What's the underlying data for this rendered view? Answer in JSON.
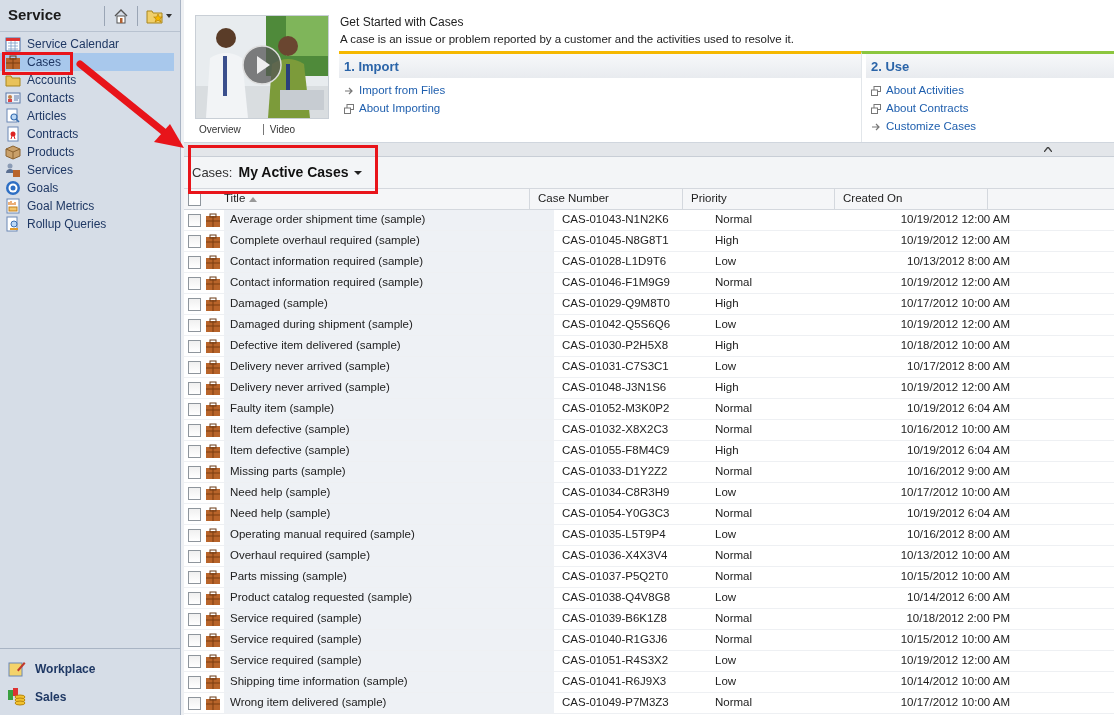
{
  "sidebar": {
    "title": "Service",
    "items": [
      {
        "label": "Service Calendar",
        "selected": false
      },
      {
        "label": "Cases",
        "selected": true
      },
      {
        "label": "Accounts",
        "selected": false
      },
      {
        "label": "Contacts",
        "selected": false
      },
      {
        "label": "Articles",
        "selected": false
      },
      {
        "label": "Contracts",
        "selected": false
      },
      {
        "label": "Products",
        "selected": false
      },
      {
        "label": "Services",
        "selected": false
      },
      {
        "label": "Goals",
        "selected": false
      },
      {
        "label": "Goal Metrics",
        "selected": false
      },
      {
        "label": "Rollup Queries",
        "selected": false
      }
    ],
    "areas": [
      {
        "label": "Workplace"
      },
      {
        "label": "Sales"
      }
    ]
  },
  "get_started": {
    "title": "Get Started with Cases",
    "description": "A case is an issue or problem reported by a customer and the activities used to resolve it.",
    "video_links": [
      "Overview",
      "Video"
    ],
    "sections": [
      {
        "heading": "1. Import",
        "color": "#f5b800",
        "links": [
          {
            "label": "Import from Files",
            "kind": "arrow"
          },
          {
            "label": "About Importing",
            "kind": "window"
          }
        ]
      },
      {
        "heading": "2. Use",
        "color": "#8cc63f",
        "links": [
          {
            "label": "About Activities",
            "kind": "window"
          },
          {
            "label": "About Contracts",
            "kind": "window"
          },
          {
            "label": "Customize Cases",
            "kind": "arrow"
          }
        ]
      }
    ]
  },
  "view": {
    "label": "Cases:",
    "name": "My Active Cases"
  },
  "table": {
    "select_all_checked": false,
    "columns": [
      "Title",
      "Case Number",
      "Priority",
      "Created On"
    ],
    "rows": [
      {
        "title": "Average order shipment time (sample)",
        "case_number": "CAS-01043-N1N2K6",
        "priority": "Normal",
        "created_on": "10/19/2012 12:00 AM",
        "checked": false
      },
      {
        "title": "Complete overhaul required (sample)",
        "case_number": "CAS-01045-N8G8T1",
        "priority": "High",
        "created_on": "10/19/2012 12:00 AM",
        "checked": false
      },
      {
        "title": "Contact information required (sample)",
        "case_number": "CAS-01028-L1D9T6",
        "priority": "Low",
        "created_on": "10/13/2012 8:00 AM",
        "checked": false
      },
      {
        "title": "Contact information required (sample)",
        "case_number": "CAS-01046-F1M9G9",
        "priority": "Normal",
        "created_on": "10/19/2012 12:00 AM",
        "checked": false
      },
      {
        "title": "Damaged (sample)",
        "case_number": "CAS-01029-Q9M8T0",
        "priority": "High",
        "created_on": "10/17/2012 10:00 AM",
        "checked": false
      },
      {
        "title": "Damaged during shipment (sample)",
        "case_number": "CAS-01042-Q5S6Q6",
        "priority": "Low",
        "created_on": "10/19/2012 12:00 AM",
        "checked": false
      },
      {
        "title": "Defective item delivered (sample)",
        "case_number": "CAS-01030-P2H5X8",
        "priority": "High",
        "created_on": "10/18/2012 10:00 AM",
        "checked": false
      },
      {
        "title": "Delivery never arrived (sample)",
        "case_number": "CAS-01031-C7S3C1",
        "priority": "Low",
        "created_on": "10/17/2012 8:00 AM",
        "checked": false
      },
      {
        "title": "Delivery never arrived (sample)",
        "case_number": "CAS-01048-J3N1S6",
        "priority": "High",
        "created_on": "10/19/2012 12:00 AM",
        "checked": false
      },
      {
        "title": "Faulty item (sample)",
        "case_number": "CAS-01052-M3K0P2",
        "priority": "Normal",
        "created_on": "10/19/2012 6:04 AM",
        "checked": false
      },
      {
        "title": "Item defective (sample)",
        "case_number": "CAS-01032-X8X2C3",
        "priority": "Normal",
        "created_on": "10/16/2012 10:00 AM",
        "checked": false
      },
      {
        "title": "Item defective (sample)",
        "case_number": "CAS-01055-F8M4C9",
        "priority": "High",
        "created_on": "10/19/2012 6:04 AM",
        "checked": false
      },
      {
        "title": "Missing parts (sample)",
        "case_number": "CAS-01033-D1Y2Z2",
        "priority": "Normal",
        "created_on": "10/16/2012 9:00 AM",
        "checked": false
      },
      {
        "title": "Need help (sample)",
        "case_number": "CAS-01034-C8R3H9",
        "priority": "Low",
        "created_on": "10/17/2012 10:00 AM",
        "checked": false
      },
      {
        "title": "Need help (sample)",
        "case_number": "CAS-01054-Y0G3C3",
        "priority": "Normal",
        "created_on": "10/19/2012 6:04 AM",
        "checked": false
      },
      {
        "title": "Operating manual required (sample)",
        "case_number": "CAS-01035-L5T9P4",
        "priority": "Low",
        "created_on": "10/16/2012 8:00 AM",
        "checked": false
      },
      {
        "title": "Overhaul required (sample)",
        "case_number": "CAS-01036-X4X3V4",
        "priority": "Normal",
        "created_on": "10/13/2012 10:00 AM",
        "checked": false
      },
      {
        "title": "Parts missing (sample)",
        "case_number": "CAS-01037-P5Q2T0",
        "priority": "Normal",
        "created_on": "10/15/2012 10:00 AM",
        "checked": false
      },
      {
        "title": "Product catalog requested (sample)",
        "case_number": "CAS-01038-Q4V8G8",
        "priority": "Low",
        "created_on": "10/14/2012 6:00 AM",
        "checked": false
      },
      {
        "title": "Service required (sample)",
        "case_number": "CAS-01039-B6K1Z8",
        "priority": "Normal",
        "created_on": "10/18/2012 2:00 PM",
        "checked": false
      },
      {
        "title": "Service required (sample)",
        "case_number": "CAS-01040-R1G3J6",
        "priority": "Normal",
        "created_on": "10/15/2012 10:00 AM",
        "checked": false
      },
      {
        "title": "Service required (sample)",
        "case_number": "CAS-01051-R4S3X2",
        "priority": "Low",
        "created_on": "10/19/2012 12:00 AM",
        "checked": false
      },
      {
        "title": "Shipping time information (sample)",
        "case_number": "CAS-01041-R6J9X3",
        "priority": "Low",
        "created_on": "10/14/2012 10:00 AM",
        "checked": false
      },
      {
        "title": "Wrong item delivered (sample)",
        "case_number": "CAS-01049-P7M3Z3",
        "priority": "Normal",
        "created_on": "10/17/2012 10:00 AM",
        "checked": false
      }
    ]
  }
}
